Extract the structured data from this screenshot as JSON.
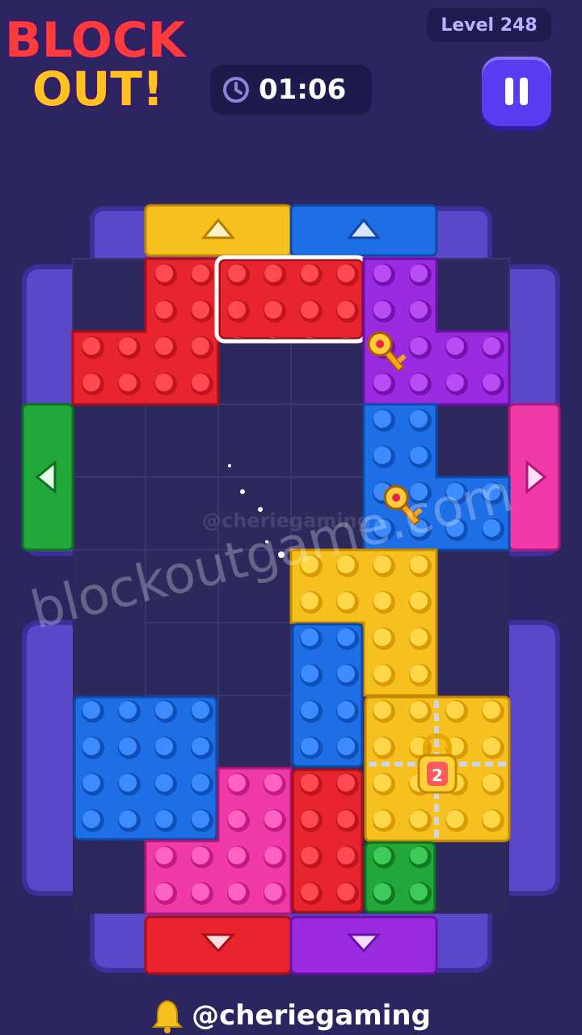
{
  "header": {
    "logo_line1": "BLOCK",
    "logo_line2": "OUT!",
    "level_label": "Level 248",
    "timer": "01:06",
    "timer_icon": "clock-icon",
    "pause_icon": "pause-icon"
  },
  "board": {
    "colors": {
      "frame": "#5a48c8",
      "frame_dark": "#3d2f9a",
      "cell": "#2e295c",
      "red": "#e8242e",
      "blue": "#1e6fe6",
      "purple": "#9b2be0",
      "yellow": "#f6c01e",
      "pink": "#f03aa8",
      "green": "#22a83a"
    },
    "locked_block_counter": "2",
    "watermark_small": "@cheriegaming",
    "watermark_large": "blockoutgame.com"
  },
  "footer": {
    "handle": "@cheriegaming",
    "bell_icon": "bell-icon"
  }
}
